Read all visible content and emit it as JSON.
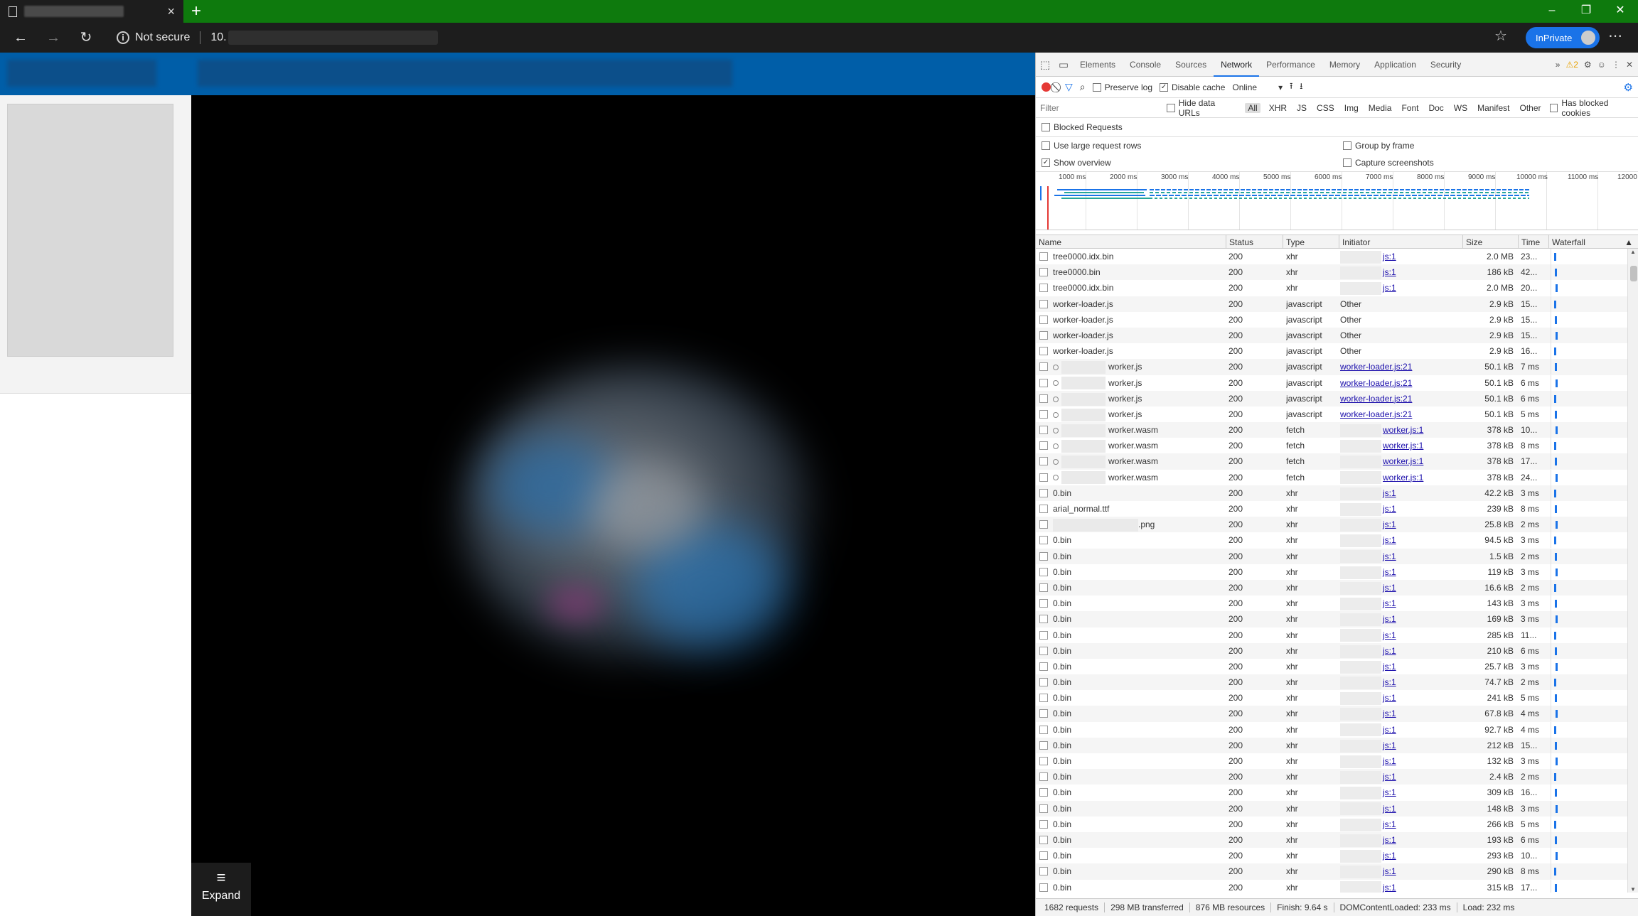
{
  "browser": {
    "new_tab_icon": "+",
    "tab_close_icon": "×",
    "window_controls": [
      "–",
      "❐",
      "✕"
    ],
    "security_label": "Not secure",
    "url_prefix": "10.",
    "inprivate_label": "InPrivate"
  },
  "page": {
    "expand_label": "Expand",
    "expand_icon": "≡"
  },
  "devtools": {
    "tabs": [
      "Elements",
      "Console",
      "Sources",
      "Network",
      "Performance",
      "Memory",
      "Application",
      "Security"
    ],
    "active_tab": "Network",
    "more_tabs_icon": "»",
    "warning_count": "2",
    "toolbar": {
      "preserve_log": "Preserve log",
      "disable_cache": "Disable cache",
      "throttle": "Online"
    },
    "filter": {
      "placeholder": "Filter",
      "hide_data_urls": "Hide data URLs",
      "types": [
        "All",
        "XHR",
        "JS",
        "CSS",
        "Img",
        "Media",
        "Font",
        "Doc",
        "WS",
        "Manifest",
        "Other"
      ],
      "has_blocked_cookies": "Has blocked cookies"
    },
    "options": {
      "blocked_requests": "Blocked Requests",
      "large_rows": "Use large request rows",
      "group_by_frame": "Group by frame",
      "show_overview": "Show overview",
      "capture_screenshots": "Capture screenshots"
    },
    "overview_ticks": [
      "1000 ms",
      "2000 ms",
      "3000 ms",
      "4000 ms",
      "5000 ms",
      "6000 ms",
      "7000 ms",
      "8000 ms",
      "9000 ms",
      "10000 ms",
      "11000 ms",
      "12000"
    ],
    "columns": [
      "Name",
      "Status",
      "Type",
      "Initiator",
      "Size",
      "Time",
      "Waterfall"
    ],
    "rows": [
      {
        "name": "tree0000.idx.bin",
        "status": "200",
        "type": "xhr",
        "initiator": "js:1",
        "size": "2.0 MB",
        "time": "23..."
      },
      {
        "name": "tree0000.bin",
        "status": "200",
        "type": "xhr",
        "initiator": "js:1",
        "size": "186 kB",
        "time": "42..."
      },
      {
        "name": "tree0000.idx.bin",
        "status": "200",
        "type": "xhr",
        "initiator": "js:1",
        "size": "2.0 MB",
        "time": "20..."
      },
      {
        "name": "worker-loader.js",
        "status": "200",
        "type": "javascript",
        "initiator": "Other",
        "size": "2.9 kB",
        "time": "15..."
      },
      {
        "name": "worker-loader.js",
        "status": "200",
        "type": "javascript",
        "initiator": "Other",
        "size": "2.9 kB",
        "time": "15..."
      },
      {
        "name": "worker-loader.js",
        "status": "200",
        "type": "javascript",
        "initiator": "Other",
        "size": "2.9 kB",
        "time": "15..."
      },
      {
        "name": "worker-loader.js",
        "status": "200",
        "type": "javascript",
        "initiator": "Other",
        "size": "2.9 kB",
        "time": "16..."
      },
      {
        "name": "worker.js",
        "status": "200",
        "type": "javascript",
        "initiator": "worker-loader.js:21",
        "size": "50.1 kB",
        "time": "7 ms"
      },
      {
        "name": "worker.js",
        "status": "200",
        "type": "javascript",
        "initiator": "worker-loader.js:21",
        "size": "50.1 kB",
        "time": "6 ms"
      },
      {
        "name": "worker.js",
        "status": "200",
        "type": "javascript",
        "initiator": "worker-loader.js:21",
        "size": "50.1 kB",
        "time": "6 ms"
      },
      {
        "name": "worker.js",
        "status": "200",
        "type": "javascript",
        "initiator": "worker-loader.js:21",
        "size": "50.1 kB",
        "time": "5 ms"
      },
      {
        "name": "worker.wasm",
        "status": "200",
        "type": "fetch",
        "initiator": "worker.js:1",
        "size": "378 kB",
        "time": "10..."
      },
      {
        "name": "worker.wasm",
        "status": "200",
        "type": "fetch",
        "initiator": "worker.js:1",
        "size": "378 kB",
        "time": "8 ms"
      },
      {
        "name": "worker.wasm",
        "status": "200",
        "type": "fetch",
        "initiator": "worker.js:1",
        "size": "378 kB",
        "time": "17..."
      },
      {
        "name": "worker.wasm",
        "status": "200",
        "type": "fetch",
        "initiator": "worker.js:1",
        "size": "378 kB",
        "time": "24..."
      },
      {
        "name": "0.bin",
        "status": "200",
        "type": "xhr",
        "initiator": "js:1",
        "size": "42.2 kB",
        "time": "3 ms"
      },
      {
        "name": "arial_normal.ttf",
        "status": "200",
        "type": "xhr",
        "initiator": "js:1",
        "size": "239 kB",
        "time": "8 ms"
      },
      {
        "name": ".png",
        "status": "200",
        "type": "xhr",
        "initiator": "js:1",
        "size": "25.8 kB",
        "time": "2 ms"
      },
      {
        "name": "0.bin",
        "status": "200",
        "type": "xhr",
        "initiator": "js:1",
        "size": "94.5 kB",
        "time": "3 ms"
      },
      {
        "name": "0.bin",
        "status": "200",
        "type": "xhr",
        "initiator": "js:1",
        "size": "1.5 kB",
        "time": "2 ms"
      },
      {
        "name": "0.bin",
        "status": "200",
        "type": "xhr",
        "initiator": "js:1",
        "size": "119 kB",
        "time": "3 ms"
      },
      {
        "name": "0.bin",
        "status": "200",
        "type": "xhr",
        "initiator": "js:1",
        "size": "16.6 kB",
        "time": "2 ms"
      },
      {
        "name": "0.bin",
        "status": "200",
        "type": "xhr",
        "initiator": "js:1",
        "size": "143 kB",
        "time": "3 ms"
      },
      {
        "name": "0.bin",
        "status": "200",
        "type": "xhr",
        "initiator": "js:1",
        "size": "169 kB",
        "time": "3 ms"
      },
      {
        "name": "0.bin",
        "status": "200",
        "type": "xhr",
        "initiator": "js:1",
        "size": "285 kB",
        "time": "11..."
      },
      {
        "name": "0.bin",
        "status": "200",
        "type": "xhr",
        "initiator": "js:1",
        "size": "210 kB",
        "time": "6 ms"
      },
      {
        "name": "0.bin",
        "status": "200",
        "type": "xhr",
        "initiator": "js:1",
        "size": "25.7 kB",
        "time": "3 ms"
      },
      {
        "name": "0.bin",
        "status": "200",
        "type": "xhr",
        "initiator": "js:1",
        "size": "74.7 kB",
        "time": "2 ms"
      },
      {
        "name": "0.bin",
        "status": "200",
        "type": "xhr",
        "initiator": "js:1",
        "size": "241 kB",
        "time": "5 ms"
      },
      {
        "name": "0.bin",
        "status": "200",
        "type": "xhr",
        "initiator": "js:1",
        "size": "67.8 kB",
        "time": "4 ms"
      },
      {
        "name": "0.bin",
        "status": "200",
        "type": "xhr",
        "initiator": "js:1",
        "size": "92.7 kB",
        "time": "4 ms"
      },
      {
        "name": "0.bin",
        "status": "200",
        "type": "xhr",
        "initiator": "js:1",
        "size": "212 kB",
        "time": "15..."
      },
      {
        "name": "0.bin",
        "status": "200",
        "type": "xhr",
        "initiator": "js:1",
        "size": "132 kB",
        "time": "3 ms"
      },
      {
        "name": "0.bin",
        "status": "200",
        "type": "xhr",
        "initiator": "js:1",
        "size": "2.4 kB",
        "time": "2 ms"
      },
      {
        "name": "0.bin",
        "status": "200",
        "type": "xhr",
        "initiator": "js:1",
        "size": "309 kB",
        "time": "16..."
      },
      {
        "name": "0.bin",
        "status": "200",
        "type": "xhr",
        "initiator": "js:1",
        "size": "148 kB",
        "time": "3 ms"
      },
      {
        "name": "0.bin",
        "status": "200",
        "type": "xhr",
        "initiator": "js:1",
        "size": "266 kB",
        "time": "5 ms"
      },
      {
        "name": "0.bin",
        "status": "200",
        "type": "xhr",
        "initiator": "js:1",
        "size": "193 kB",
        "time": "6 ms"
      },
      {
        "name": "0.bin",
        "status": "200",
        "type": "xhr",
        "initiator": "js:1",
        "size": "293 kB",
        "time": "10..."
      },
      {
        "name": "0.bin",
        "status": "200",
        "type": "xhr",
        "initiator": "js:1",
        "size": "290 kB",
        "time": "8 ms"
      },
      {
        "name": "0.bin",
        "status": "200",
        "type": "xhr",
        "initiator": "js:1",
        "size": "315 kB",
        "time": "17..."
      }
    ],
    "status_bar": {
      "requests": "1682 requests",
      "transferred": "298 MB transferred",
      "resources": "876 MB resources",
      "finish": "Finish: 9.64 s",
      "dom_content_loaded": "DOMContentLoaded: 233 ms",
      "load": "Load: 232 ms"
    }
  },
  "colors": {
    "tabstrip": "#0e7a0d",
    "page_header": "#005ea8",
    "accent": "#1a73e8",
    "record": "#e53935"
  }
}
